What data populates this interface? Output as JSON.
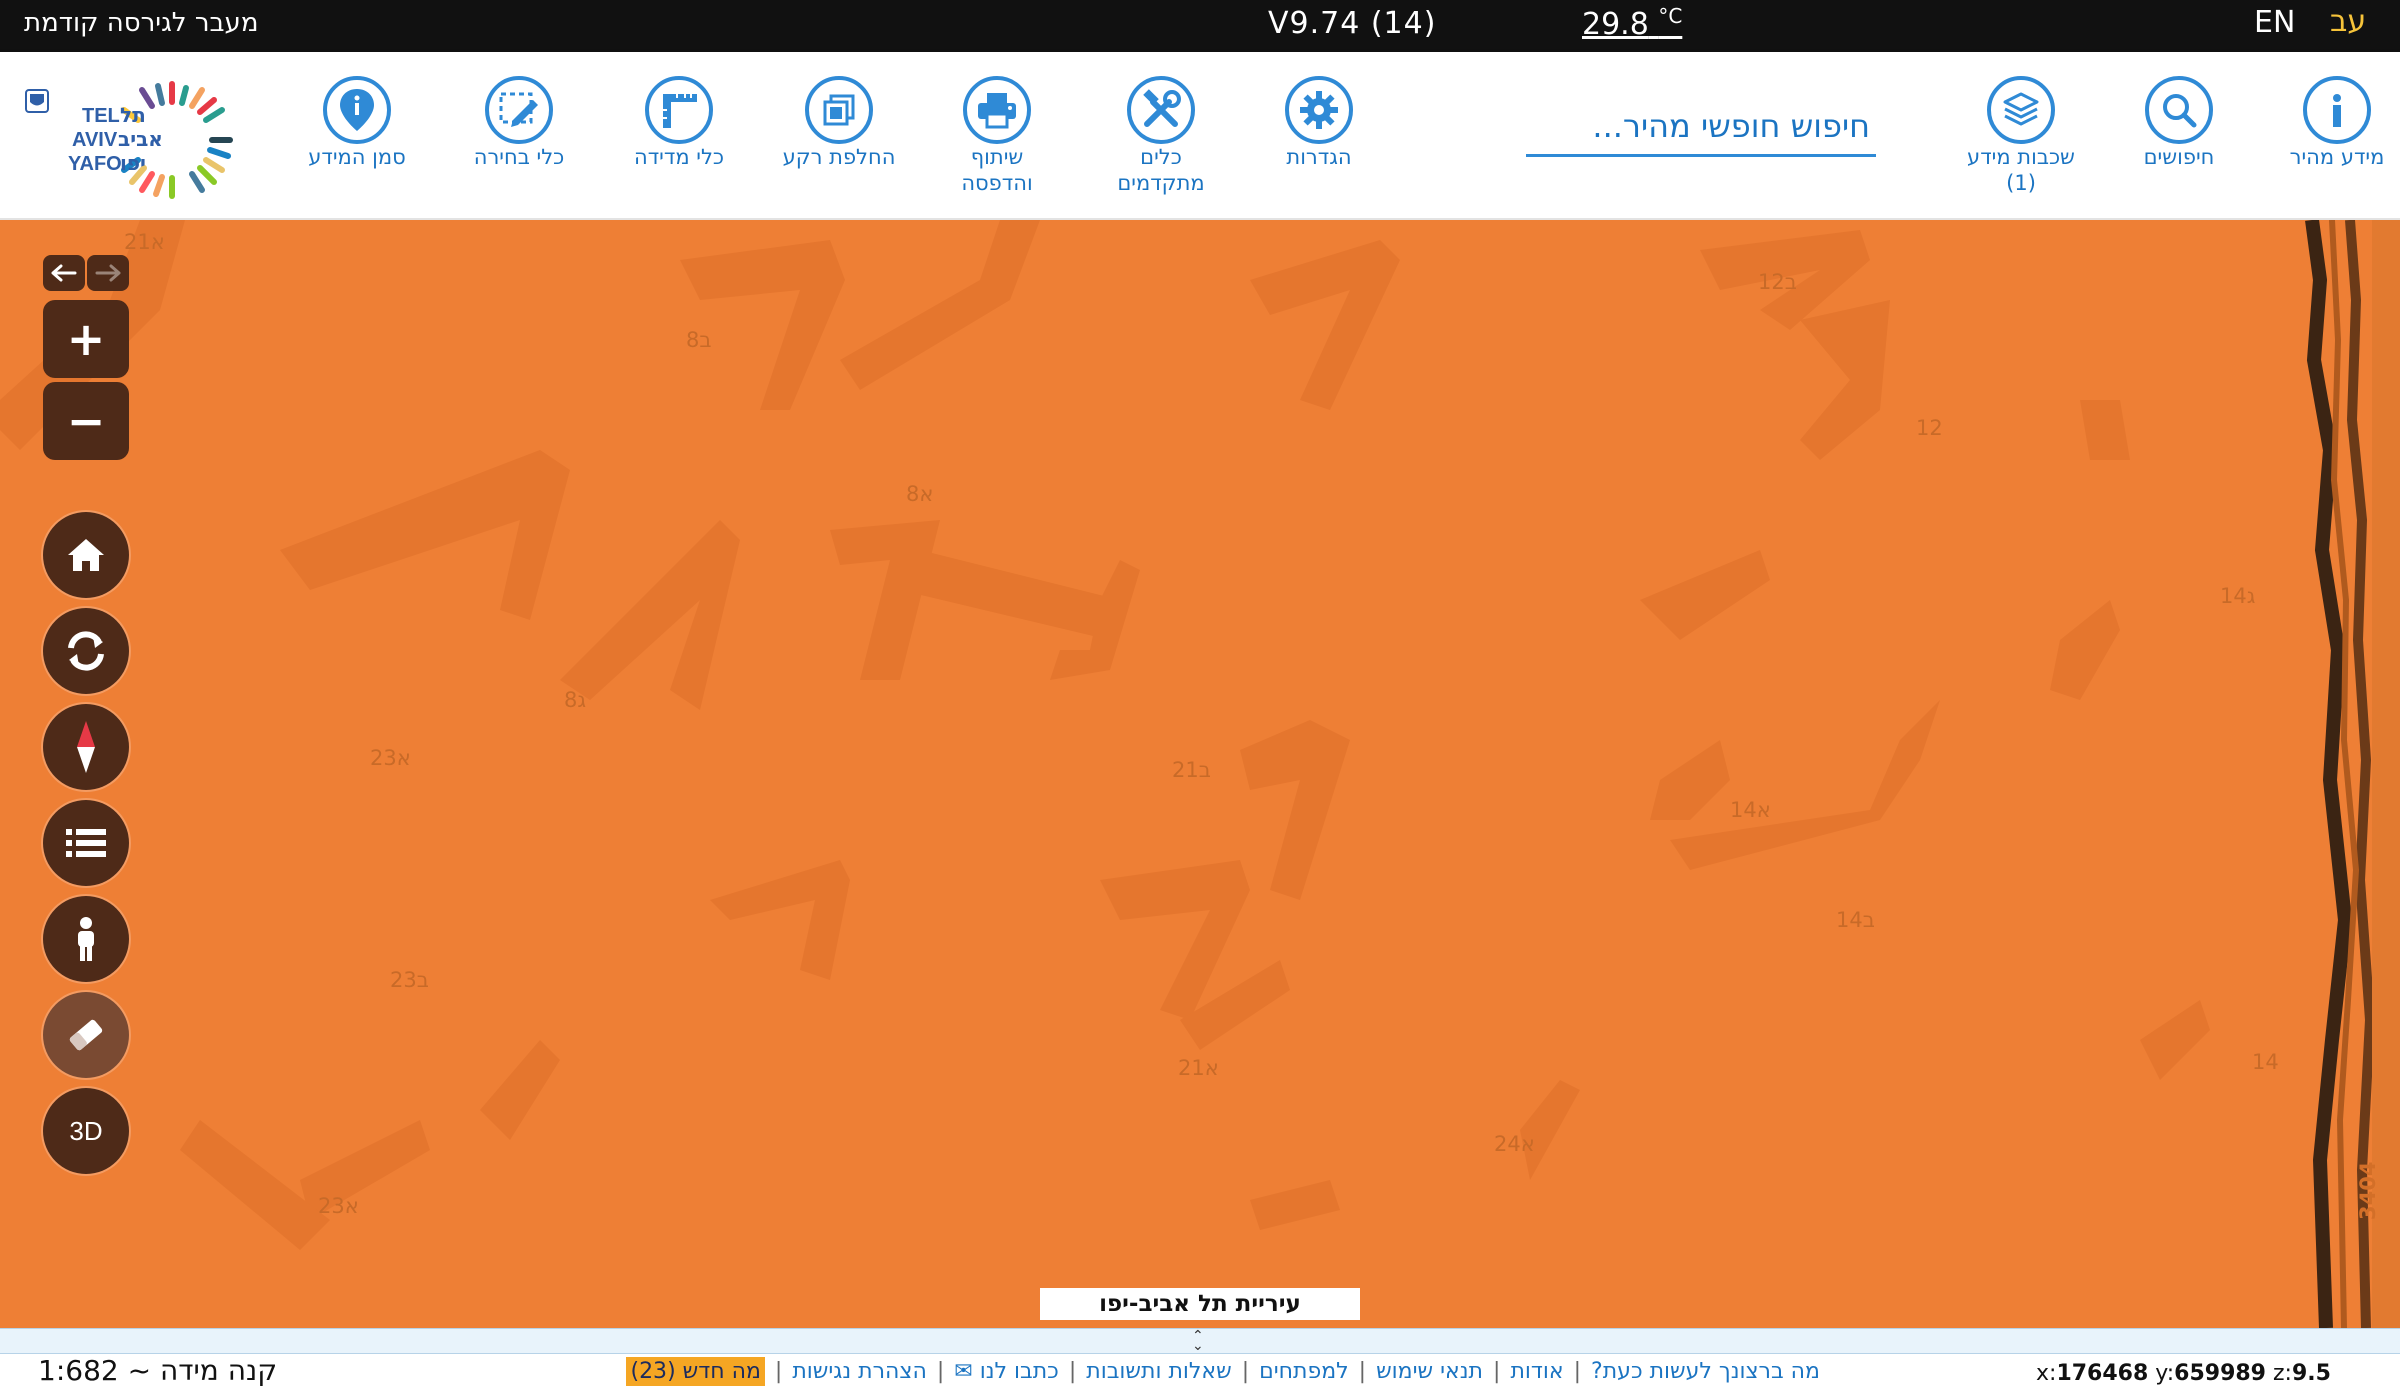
{
  "topbar": {
    "previous_version": "מעבר לגירסה קודמת",
    "version": "V9.74 (14)",
    "temperature": "29.8",
    "temperature_unit": "°C",
    "lang_en": "EN",
    "lang_he": "עב"
  },
  "toolbar": {
    "info_marker": "סמן המידע",
    "selection_tools": "כלי בחירה",
    "measure_tools": "כלי מדידה",
    "basemap_switch": "החלפת רקע",
    "share_print_1": "שיתוף",
    "share_print_2": "והדפסה",
    "advanced_tools_1": "כלים",
    "advanced_tools_2": "מתקדמים",
    "settings": "הגדרות",
    "search_placeholder": "חיפוש חופשי מהיר...",
    "layers_1": "שכבות מידע",
    "layers_2": "(1)",
    "searches": "חיפושים",
    "quick_info": "מידע מהיר"
  },
  "logo": {
    "text_en_1": "TEL",
    "text_en_2": "AVIV",
    "text_en_3": "YAFO",
    "text_he_1": "תל",
    "text_he_2": "אביב",
    "text_he_3": "יפו"
  },
  "map": {
    "city_label": "עיריית תל אביב-יפו",
    "controls": {
      "zoom_in": "+",
      "zoom_out": "−",
      "mode_3d": "3D"
    },
    "parcel_labels": [
      "21א",
      "8ב",
      "8א",
      "8ג",
      "23א",
      "23ב",
      "23א",
      "21ב",
      "21א",
      "24א",
      "12ב",
      "12",
      "14ג",
      "14א",
      "14ב",
      "14",
      "3404"
    ]
  },
  "footer": {
    "scale_label": "קנה מידה ~ 1:682",
    "links": [
      "מה ברצונך לעשות כעת?",
      "אודות",
      "תנאי שימוש",
      "למפתחים",
      "שאלות ותשובות",
      "כתבו לנו ✉",
      "הצהרת נגישות"
    ],
    "whats_new": "מה חדש (23)",
    "coord_x_label": "x:",
    "coord_x": "176468",
    "coord_y_label": "y:",
    "coord_y": "659989",
    "coord_z_label": "z:",
    "coord_z": "9.5"
  },
  "colors": {
    "map_fill": "#ee7f35",
    "accent_blue": "#2f8ad6",
    "control_brown": "#4e2a18",
    "lang_yellow": "#f6c33a"
  }
}
